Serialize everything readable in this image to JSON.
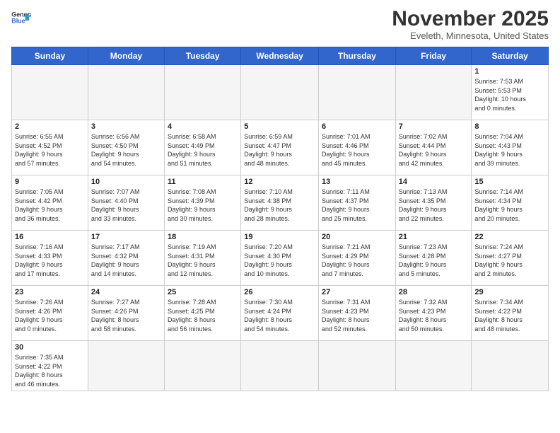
{
  "logo": {
    "line1": "General",
    "line2": "Blue"
  },
  "title": "November 2025",
  "location": "Eveleth, Minnesota, United States",
  "weekdays": [
    "Sunday",
    "Monday",
    "Tuesday",
    "Wednesday",
    "Thursday",
    "Friday",
    "Saturday"
  ],
  "weeks": [
    [
      {
        "day": "",
        "info": ""
      },
      {
        "day": "",
        "info": ""
      },
      {
        "day": "",
        "info": ""
      },
      {
        "day": "",
        "info": ""
      },
      {
        "day": "",
        "info": ""
      },
      {
        "day": "",
        "info": ""
      },
      {
        "day": "1",
        "info": "Sunrise: 7:53 AM\nSunset: 5:53 PM\nDaylight: 10 hours\nand 0 minutes."
      }
    ],
    [
      {
        "day": "2",
        "info": "Sunrise: 6:55 AM\nSunset: 4:52 PM\nDaylight: 9 hours\nand 57 minutes."
      },
      {
        "day": "3",
        "info": "Sunrise: 6:56 AM\nSunset: 4:50 PM\nDaylight: 9 hours\nand 54 minutes."
      },
      {
        "day": "4",
        "info": "Sunrise: 6:58 AM\nSunset: 4:49 PM\nDaylight: 9 hours\nand 51 minutes."
      },
      {
        "day": "5",
        "info": "Sunrise: 6:59 AM\nSunset: 4:47 PM\nDaylight: 9 hours\nand 48 minutes."
      },
      {
        "day": "6",
        "info": "Sunrise: 7:01 AM\nSunset: 4:46 PM\nDaylight: 9 hours\nand 45 minutes."
      },
      {
        "day": "7",
        "info": "Sunrise: 7:02 AM\nSunset: 4:44 PM\nDaylight: 9 hours\nand 42 minutes."
      },
      {
        "day": "8",
        "info": "Sunrise: 7:04 AM\nSunset: 4:43 PM\nDaylight: 9 hours\nand 39 minutes."
      }
    ],
    [
      {
        "day": "9",
        "info": "Sunrise: 7:05 AM\nSunset: 4:42 PM\nDaylight: 9 hours\nand 36 minutes."
      },
      {
        "day": "10",
        "info": "Sunrise: 7:07 AM\nSunset: 4:40 PM\nDaylight: 9 hours\nand 33 minutes."
      },
      {
        "day": "11",
        "info": "Sunrise: 7:08 AM\nSunset: 4:39 PM\nDaylight: 9 hours\nand 30 minutes."
      },
      {
        "day": "12",
        "info": "Sunrise: 7:10 AM\nSunset: 4:38 PM\nDaylight: 9 hours\nand 28 minutes."
      },
      {
        "day": "13",
        "info": "Sunrise: 7:11 AM\nSunset: 4:37 PM\nDaylight: 9 hours\nand 25 minutes."
      },
      {
        "day": "14",
        "info": "Sunrise: 7:13 AM\nSunset: 4:35 PM\nDaylight: 9 hours\nand 22 minutes."
      },
      {
        "day": "15",
        "info": "Sunrise: 7:14 AM\nSunset: 4:34 PM\nDaylight: 9 hours\nand 20 minutes."
      }
    ],
    [
      {
        "day": "16",
        "info": "Sunrise: 7:16 AM\nSunset: 4:33 PM\nDaylight: 9 hours\nand 17 minutes."
      },
      {
        "day": "17",
        "info": "Sunrise: 7:17 AM\nSunset: 4:32 PM\nDaylight: 9 hours\nand 14 minutes."
      },
      {
        "day": "18",
        "info": "Sunrise: 7:19 AM\nSunset: 4:31 PM\nDaylight: 9 hours\nand 12 minutes."
      },
      {
        "day": "19",
        "info": "Sunrise: 7:20 AM\nSunset: 4:30 PM\nDaylight: 9 hours\nand 10 minutes."
      },
      {
        "day": "20",
        "info": "Sunrise: 7:21 AM\nSunset: 4:29 PM\nDaylight: 9 hours\nand 7 minutes."
      },
      {
        "day": "21",
        "info": "Sunrise: 7:23 AM\nSunset: 4:28 PM\nDaylight: 9 hours\nand 5 minutes."
      },
      {
        "day": "22",
        "info": "Sunrise: 7:24 AM\nSunset: 4:27 PM\nDaylight: 9 hours\nand 2 minutes."
      }
    ],
    [
      {
        "day": "23",
        "info": "Sunrise: 7:26 AM\nSunset: 4:26 PM\nDaylight: 9 hours\nand 0 minutes."
      },
      {
        "day": "24",
        "info": "Sunrise: 7:27 AM\nSunset: 4:26 PM\nDaylight: 8 hours\nand 58 minutes."
      },
      {
        "day": "25",
        "info": "Sunrise: 7:28 AM\nSunset: 4:25 PM\nDaylight: 8 hours\nand 56 minutes."
      },
      {
        "day": "26",
        "info": "Sunrise: 7:30 AM\nSunset: 4:24 PM\nDaylight: 8 hours\nand 54 minutes."
      },
      {
        "day": "27",
        "info": "Sunrise: 7:31 AM\nSunset: 4:23 PM\nDaylight: 8 hours\nand 52 minutes."
      },
      {
        "day": "28",
        "info": "Sunrise: 7:32 AM\nSunset: 4:23 PM\nDaylight: 8 hours\nand 50 minutes."
      },
      {
        "day": "29",
        "info": "Sunrise: 7:34 AM\nSunset: 4:22 PM\nDaylight: 8 hours\nand 48 minutes."
      }
    ],
    [
      {
        "day": "30",
        "info": "Sunrise: 7:35 AM\nSunset: 4:22 PM\nDaylight: 8 hours\nand 46 minutes."
      },
      {
        "day": "",
        "info": ""
      },
      {
        "day": "",
        "info": ""
      },
      {
        "day": "",
        "info": ""
      },
      {
        "day": "",
        "info": ""
      },
      {
        "day": "",
        "info": ""
      },
      {
        "day": "",
        "info": ""
      }
    ]
  ]
}
